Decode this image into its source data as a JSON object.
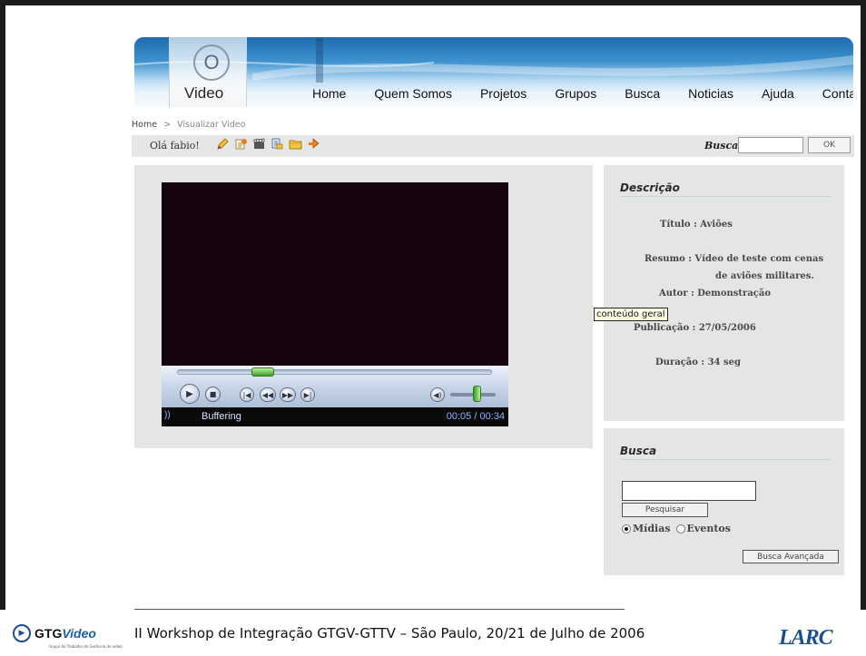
{
  "site": {
    "logo_label": "Video",
    "logo_glyph": "O",
    "nav": [
      "Home",
      "Quem Somos",
      "Projetos",
      "Grupos",
      "Busca",
      "Noticias",
      "Ajuda",
      "Contato"
    ]
  },
  "breadcrumb": {
    "home": "Home",
    "separator": ">",
    "current": "Visualizar Video"
  },
  "toolbar": {
    "greeting": "Olá fabio!",
    "icons": [
      "edit-icon",
      "upload-icon",
      "clapper-icon",
      "people-icon",
      "folder-icon",
      "print-icon"
    ],
    "search_label": "Busca",
    "search_value": "",
    "search_button": "OK"
  },
  "player": {
    "seek_fraction": 0.16,
    "volume_fraction": 0.6,
    "status": "Buffering",
    "status_mark": "))",
    "time": "00:05 / 00:34",
    "button_glyphs": {
      "play": "▶",
      "stop": "■",
      "skip_back": "|◀",
      "rewind": "◀◀",
      "fast_forward": "▶▶",
      "skip_forward": "▶|",
      "mute": "◀)"
    }
  },
  "description": {
    "heading": "Descrição",
    "titulo_label": "Título :",
    "titulo": "Aviões",
    "resumo_label": "Resumo :",
    "resumo_line1": "Vídeo de teste com cenas",
    "resumo_line2": "de aviões militares.",
    "autor_label": "Autor :",
    "autor": "Demonstração",
    "publicacao_label": "Publicação :",
    "publicacao": "27/05/2006",
    "duracao_label": "Duração :",
    "duracao": "34 seg",
    "tooltip": "conteúdo geral"
  },
  "busca": {
    "heading": "Busca",
    "input_value": "",
    "button": "Pesquisar",
    "option_midias": "Mídias",
    "option_eventos": "Eventos",
    "selected": "Mídias",
    "advanced_button": "Busca Avançada"
  },
  "footer": {
    "logo_main": "GTG",
    "logo_alt": "Video",
    "logo_sub": "Grupo de Trabalho de Gerência de vídeo",
    "text": "II Workshop de Integração GTGV-GTTV – São Paulo, 20/21 de Julho de 2006",
    "partner_logo": "LARC"
  },
  "colors": {
    "panel_bg": "#e3e6e3",
    "header_blue": "#1e6cae",
    "player_bg": "#150410"
  }
}
